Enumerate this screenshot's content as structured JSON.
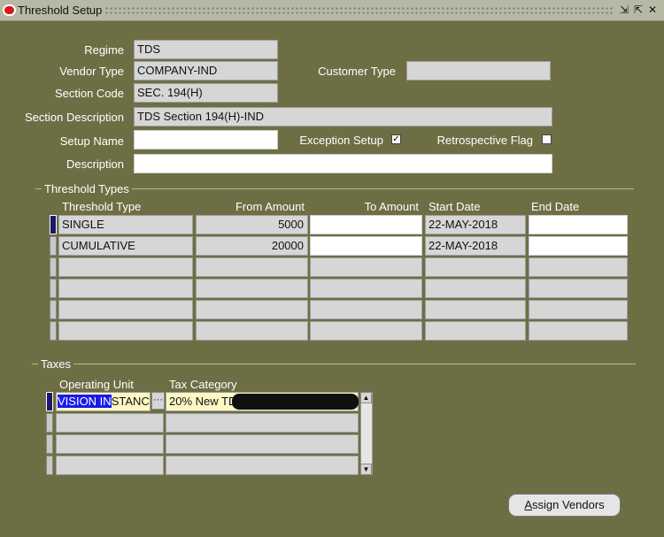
{
  "window": {
    "title": "Threshold Setup",
    "controls": [
      "⇲",
      "⇱",
      "✕"
    ]
  },
  "form": {
    "regime": {
      "label": "Regime",
      "value": "TDS"
    },
    "vendor_type": {
      "label": "Vendor Type",
      "value": "COMPANY-IND"
    },
    "customer_type": {
      "label": "Customer Type",
      "value": ""
    },
    "section_code": {
      "label": "Section Code",
      "value": "SEC. 194(H)"
    },
    "section_description": {
      "label": "Section Description",
      "value": "TDS Section 194(H)-IND"
    },
    "setup_name": {
      "label": "Setup Name",
      "value": ""
    },
    "exception_setup": {
      "label": "Exception Setup",
      "checked": true,
      "mark": "✓"
    },
    "retrospective_flag": {
      "label": "Retrospective Flag",
      "checked": false,
      "mark": ""
    },
    "description": {
      "label": "Description",
      "value": ""
    }
  },
  "threshold_types": {
    "title": "Threshold Types",
    "columns": [
      "Threshold Type",
      "From Amount",
      "To Amount",
      "Start Date",
      "End Date"
    ],
    "rows": [
      [
        "SINGLE",
        "5000",
        "",
        "22-MAY-2018",
        ""
      ],
      [
        "CUMULATIVE",
        "20000",
        "",
        "22-MAY-2018",
        ""
      ],
      [
        "",
        "",
        "",
        "",
        ""
      ],
      [
        "",
        "",
        "",
        "",
        ""
      ],
      [
        "",
        "",
        "",
        "",
        ""
      ],
      [
        "",
        "",
        "",
        "",
        ""
      ]
    ]
  },
  "taxes": {
    "title": "Taxes",
    "columns": [
      "Operating Unit",
      "Tax Category"
    ],
    "rows": [
      {
        "unit_selected": "VISION IN",
        "unit_rest": "STANCI",
        "category": "20% New TD"
      },
      {
        "unit_selected": "",
        "unit_rest": "",
        "category": ""
      },
      {
        "unit_selected": "",
        "unit_rest": "",
        "category": ""
      },
      {
        "unit_selected": "",
        "unit_rest": "",
        "category": ""
      }
    ],
    "lov_glyph": "···"
  },
  "assign_vendors": {
    "label_prefix": "",
    "label_underline": "A",
    "label_rest": "ssign Vendors"
  }
}
